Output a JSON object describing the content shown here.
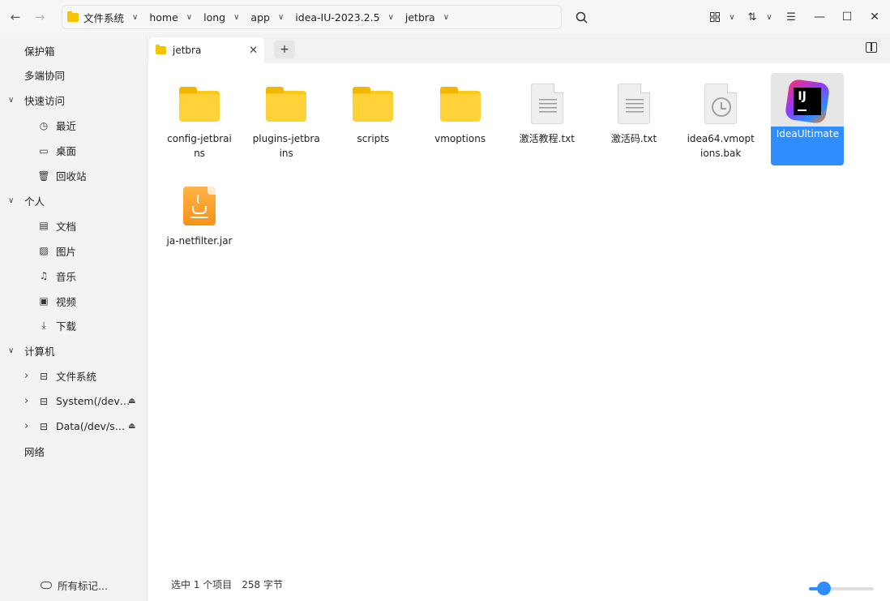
{
  "titlebar": {
    "breadcrumbs": [
      {
        "label": "文件系统",
        "folder_icon": true
      },
      {
        "label": "home"
      },
      {
        "label": "long"
      },
      {
        "label": "app"
      },
      {
        "label": "idea-IU-2023.2.5"
      },
      {
        "label": "jetbra"
      }
    ],
    "icons": {
      "back": "back-arrow-icon",
      "forward": "forward-arrow-icon",
      "search": "search-icon",
      "view": "grid-view-icon",
      "sort": "sort-icon",
      "menu": "menu-icon",
      "minimize": "minimize-icon",
      "maximize": "maximize-icon",
      "close": "close-icon"
    }
  },
  "sidebar": {
    "items": [
      {
        "label": "保护箱",
        "level": 0
      },
      {
        "label": "多端协同",
        "level": 0
      },
      {
        "label": "快速访问",
        "level": 0,
        "expanded": true
      },
      {
        "label": "最近",
        "level": 1,
        "icon": "clock-icon"
      },
      {
        "label": "桌面",
        "level": 1,
        "icon": "desktop-icon"
      },
      {
        "label": "回收站",
        "level": 1,
        "icon": "trash-icon"
      },
      {
        "label": "个人",
        "level": 0,
        "expanded": true
      },
      {
        "label": "文档",
        "level": 1,
        "icon": "document-icon"
      },
      {
        "label": "图片",
        "level": 1,
        "icon": "image-icon"
      },
      {
        "label": "音乐",
        "level": 1,
        "icon": "music-icon"
      },
      {
        "label": "视频",
        "level": 1,
        "icon": "video-icon"
      },
      {
        "label": "下载",
        "level": 1,
        "icon": "download-icon"
      },
      {
        "label": "计算机",
        "level": 0,
        "expanded": true
      },
      {
        "label": "文件系统",
        "level": 1,
        "icon": "drive-icon",
        "collapsed": true
      },
      {
        "label": "System(/dev…",
        "level": 1,
        "icon": "drive-icon",
        "collapsed": true,
        "eject": true
      },
      {
        "label": "Data(/dev/s…",
        "level": 1,
        "icon": "drive-icon",
        "collapsed": true,
        "eject": true
      },
      {
        "label": "网络",
        "level": 0
      }
    ],
    "tags_label": "所有标记..."
  },
  "tabs": [
    {
      "label": "jetbra",
      "active": true
    }
  ],
  "files": [
    {
      "name": "config-jetbrains",
      "type": "folder"
    },
    {
      "name": "plugins-jetbrains",
      "type": "folder"
    },
    {
      "name": "scripts",
      "type": "folder"
    },
    {
      "name": "vmoptions",
      "type": "folder"
    },
    {
      "name": "激活教程.txt",
      "type": "text"
    },
    {
      "name": "激活码.txt",
      "type": "text"
    },
    {
      "name": "idea64.vmoptions.bak",
      "type": "backup"
    },
    {
      "name": "IdeaUltimate",
      "type": "app",
      "selected": true
    },
    {
      "name": "ja-netfilter.jar",
      "type": "jar"
    }
  ],
  "status": {
    "selection": "选中 1 个项目",
    "size": "258 字节",
    "zoom_fraction": 0.22
  },
  "colors": {
    "accent": "#2f8eff",
    "folder": "#ffd23a"
  }
}
